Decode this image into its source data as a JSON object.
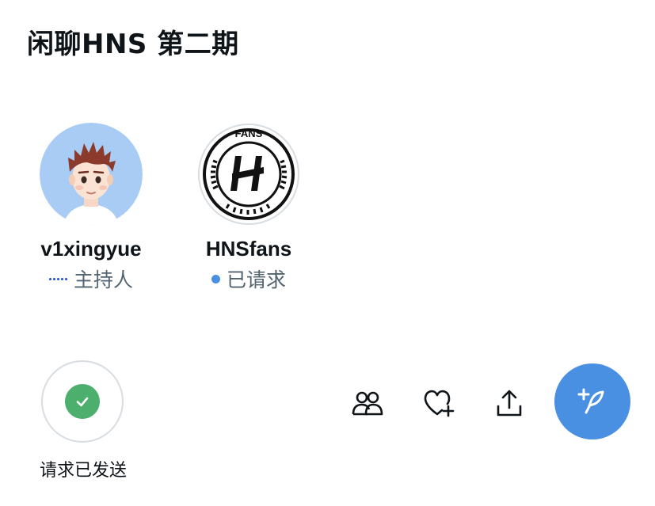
{
  "header": {
    "title": "闲聊HNS 第二期"
  },
  "speakers": [
    {
      "name": "v1xingyue",
      "role": "主持人",
      "avatar": "cartoon-boy-avatar"
    },
    {
      "name": "HNSfans",
      "role": "已请求",
      "avatar": "hns-fans-logo",
      "logo_text": "FANS"
    }
  ],
  "request": {
    "label": "请求已发送",
    "icon": "check-icon"
  },
  "toolbar": {
    "icons": [
      "people-icon",
      "heart-plus-icon",
      "share-icon",
      "compose-tweet-icon"
    ]
  },
  "colors": {
    "accent": "#4a90e2",
    "success": "#4caf6e",
    "host_dots": "#1d4ed8"
  }
}
